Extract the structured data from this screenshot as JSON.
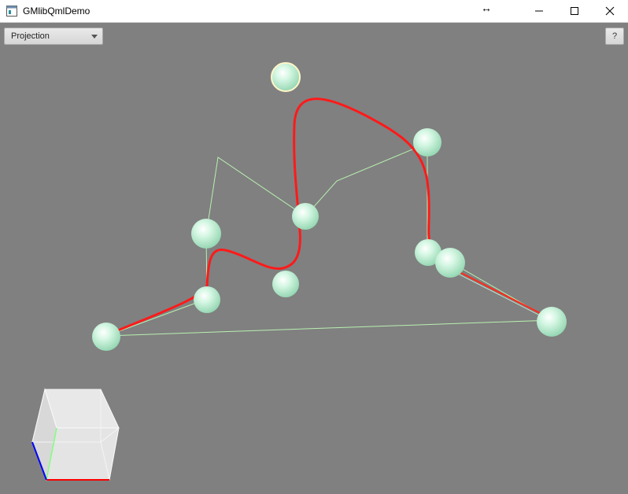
{
  "window": {
    "title": "GMlibQmlDemo",
    "icon": "app-window-icon",
    "controls": [
      "minimize-icon",
      "maximize-icon",
      "close-icon"
    ],
    "cursor_icon": "horizontal-resize-cursor"
  },
  "toolbar": {
    "projection_dropdown": {
      "selected": "Projection"
    },
    "help_label": "?"
  },
  "scene": {
    "background": "#808080",
    "curve_color": "#ff1a1a",
    "control_polygon_color": "#b8f0b0",
    "control_point_color": "#c8f5dc",
    "selected_point_outline": "#fff6c8",
    "axis_colors": {
      "x": "#ff0000",
      "y": "#7fff7f",
      "z": "#0000ff"
    }
  }
}
